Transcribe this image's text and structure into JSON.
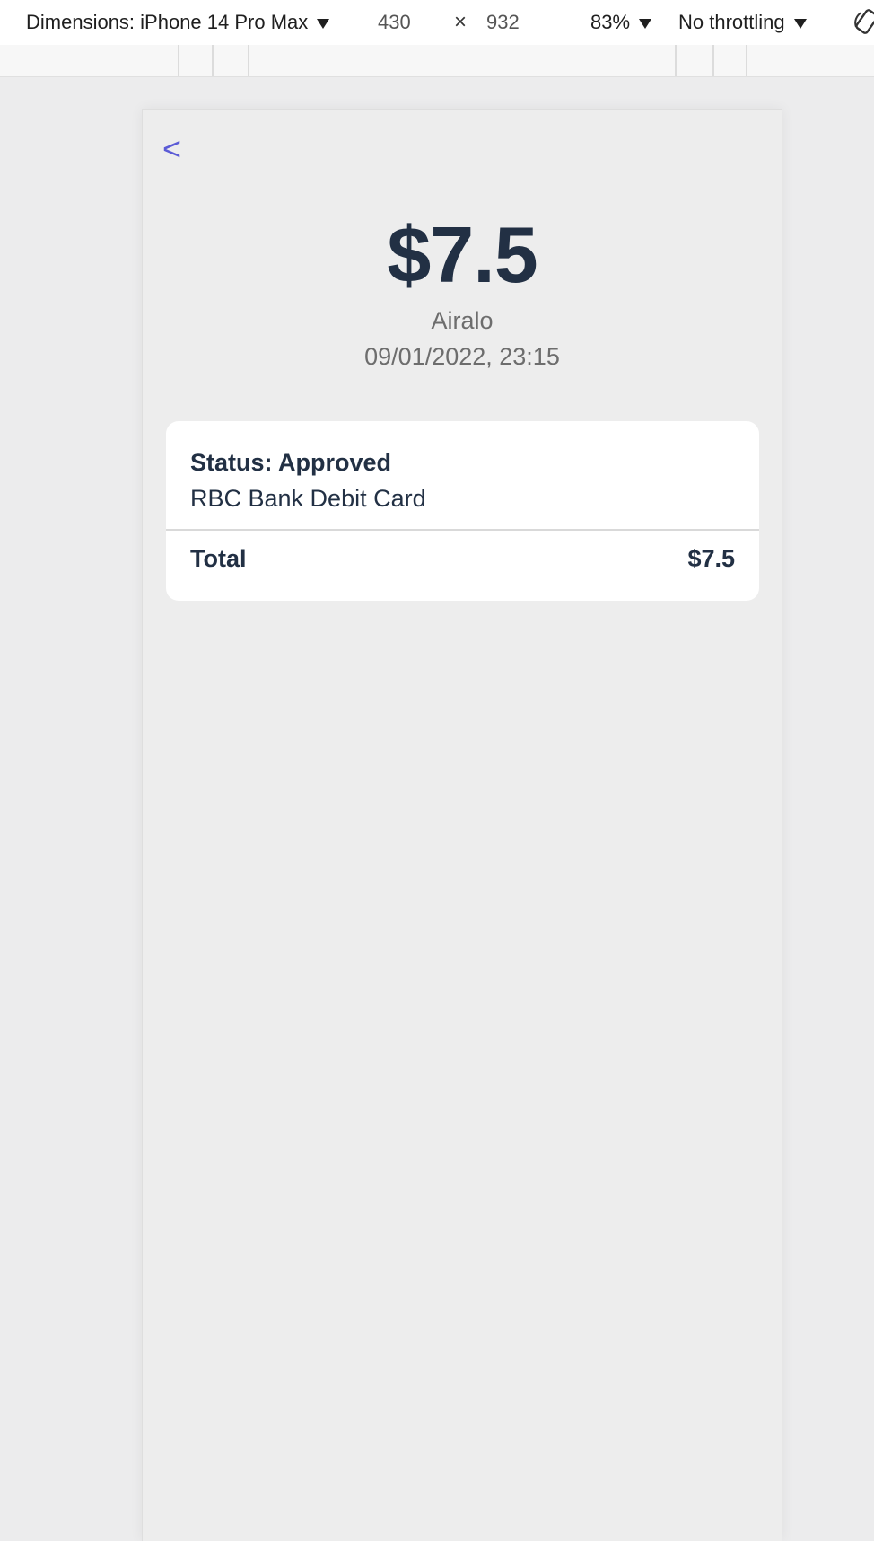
{
  "devtools": {
    "dimensions_label": "Dimensions: iPhone 14 Pro Max",
    "width": "430",
    "times": "×",
    "height": "932",
    "zoom": "83%",
    "throttling": "No throttling",
    "rotate_icon": "rotate-device-icon"
  },
  "transaction": {
    "back_label": "<",
    "amount": "$7.5",
    "merchant": "Airalo",
    "datetime": "09/01/2022, 23:15",
    "status": "Status: Approved",
    "payment_method": "RBC Bank Debit Card",
    "total_label": "Total",
    "total_value": "$7.5"
  },
  "colors": {
    "accent": "#5b5bd6",
    "text_dark": "#223044",
    "text_muted": "#6d6d6d",
    "background": "#ededed",
    "card": "#ffffff"
  }
}
